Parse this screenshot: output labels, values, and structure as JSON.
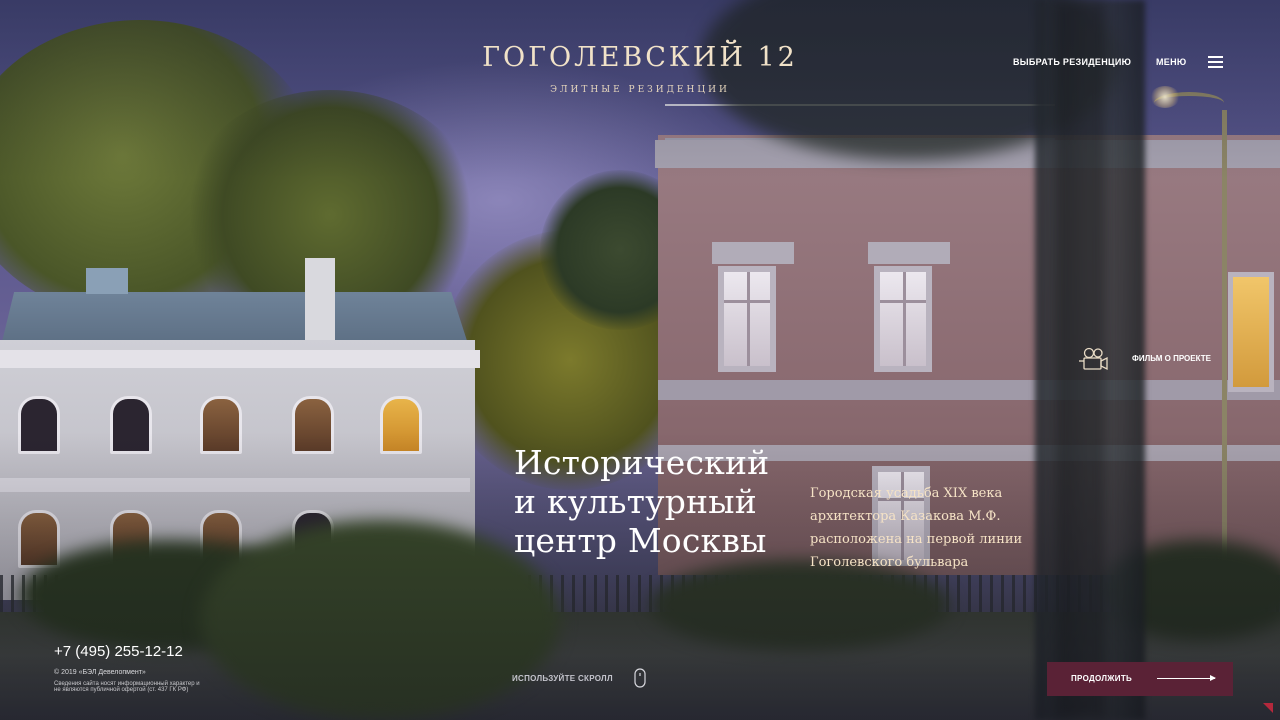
{
  "brand": {
    "title": "ГОГОЛЕВСКИЙ 12",
    "subtitle": "ЭЛИТНЫЕ РЕЗИДЕНЦИИ"
  },
  "nav": {
    "choose_residence": "ВЫБРАТЬ РЕЗИДЕНЦИЮ",
    "menu": "МЕНЮ",
    "menu_icon": "hamburger-icon"
  },
  "film": {
    "label": "ФИЛЬМ О ПРОЕКТЕ",
    "icon": "film-camera-icon"
  },
  "hero": {
    "headline_lines": [
      "Исторический",
      "и культурный",
      "центр Москвы"
    ],
    "description_lines": [
      "Городская усадьба XIX века",
      "архитектора Казакова М.Ф.",
      "расположена на первой линии",
      "Гоголевского бульвара"
    ]
  },
  "footer": {
    "phone": "+7 (495) 255-12-12",
    "copyright": "© 2019 «БЭЛ Девелопмент»",
    "legal": "Сведения сайта носят информационный характер и не являются публичной офертой (ст. 437 ГК РФ)",
    "scroll_hint": "ИСПОЛЬЗУЙТЕ СКРОЛЛ",
    "scroll_icon": "mouse-icon",
    "continue": "ПРОДОЛЖИТЬ",
    "continue_icon": "arrow-right-icon"
  },
  "colors": {
    "accent": "#5a2236",
    "logo": "#f1e2c8",
    "description": "#f6e3c6",
    "corner": "#b4283c"
  }
}
